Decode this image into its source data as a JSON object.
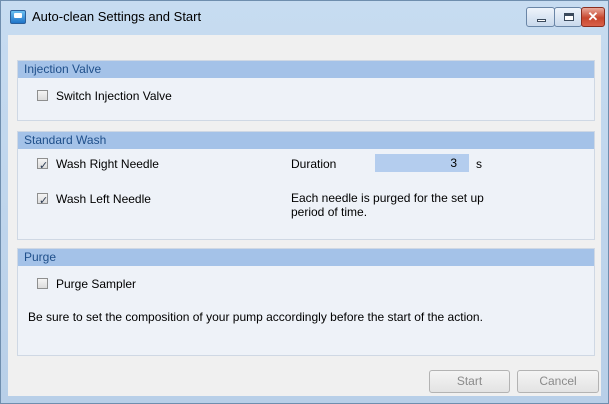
{
  "window": {
    "title": "Auto-clean Settings and Start",
    "close_glyph": "✕"
  },
  "injection_valve": {
    "header": "Injection Valve",
    "switch_label": "Switch Injection Valve",
    "switch_checked": false
  },
  "standard_wash": {
    "header": "Standard Wash",
    "right_label": "Wash Right Needle",
    "right_checked": true,
    "left_label": "Wash Left Needle",
    "left_checked": true,
    "duration_label": "Duration",
    "duration_value": "3",
    "duration_unit": "s",
    "note_line1": "Each needle is purged for the set up",
    "note_line2": "period of time."
  },
  "purge": {
    "header": "Purge",
    "sampler_label": "Purge Sampler",
    "sampler_checked": false,
    "hint": "Be sure to set the composition of your pump accordingly before the start of the action."
  },
  "footer": {
    "start_label": "Start",
    "cancel_label": "Cancel"
  },
  "colors": {
    "header_bg": "#a4c2e8",
    "header_text": "#1f4f8a",
    "input_bg": "#b4cdee"
  },
  "icons": {
    "app": "app-icon",
    "minimize": "minimize-icon",
    "maximize": "maximize-icon",
    "close": "close-icon",
    "check": "check-icon"
  }
}
